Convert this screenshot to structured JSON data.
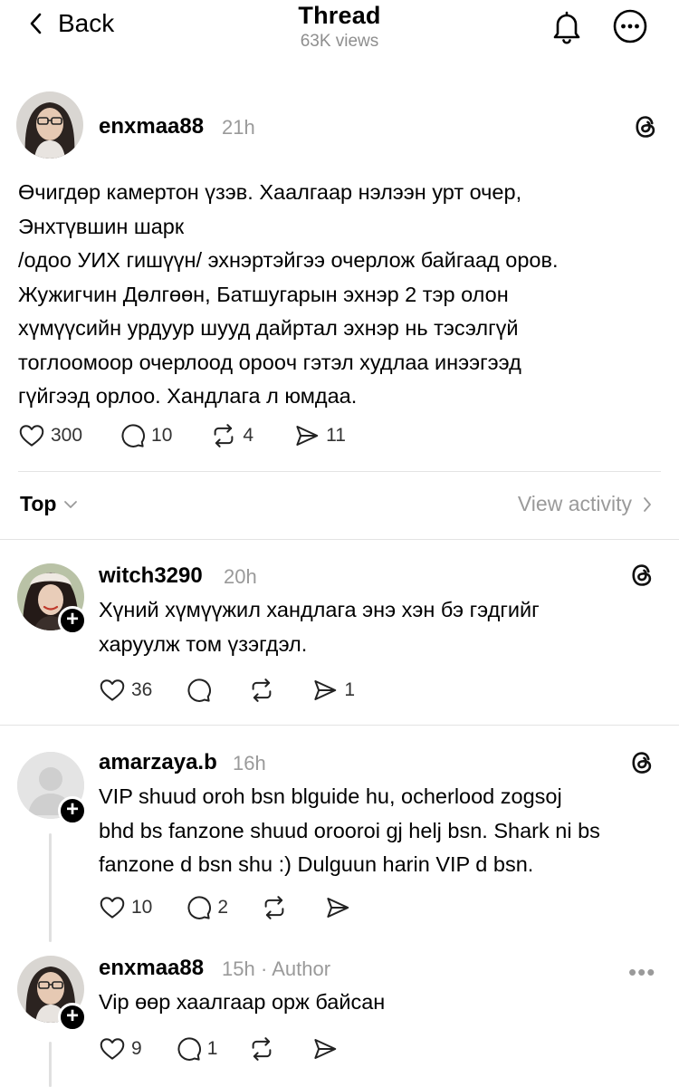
{
  "header": {
    "back_label": "Back",
    "title": "Thread",
    "views": "63K views"
  },
  "post": {
    "username": "enxmaa88",
    "time": "21h",
    "lines": [
      "Өчигдөр камертон үзэв. Хаалгаар нэлээн урт очер,",
      "Энхтүвшин шарк",
      "/одоо УИХ гишүүн/ эхнэртэйгээ очерлож байгаад оров.",
      "Жужигчин Дөлгөөн, Батшугарын эхнэр 2 тэр олон",
      "хүмүүсийн урдуур шууд дайртал эхнэр нь тэсэлгүй",
      "тоглоомоор очерлоод ороoч гэтэл худлаа инээгээд",
      "гүйгээд орлоо. Хандлага л юмдаа."
    ],
    "likes": "300",
    "comments": "10",
    "reposts": "4",
    "shares": "11"
  },
  "sort": {
    "label": "Top",
    "view_activity": "View activity"
  },
  "replies": [
    {
      "username": "witch3290",
      "time": "20h",
      "lines": [
        "Хүний хүмүүжил хандлага  энэ хэн бэ гэдгийг",
        "харуулж том үзэгдэл."
      ],
      "likes": "36",
      "comments": "",
      "reposts": "",
      "shares": "1"
    },
    {
      "username": "amarzaya.b",
      "time": "16h",
      "lines": [
        "VIP shuud oroh bsn blguide hu, ocherlood zogsoj",
        "bhd bs fanzone shuud orooroi gj helj bsn. Shark ni bs",
        "fanzone d bsn shu :) Dulguun harin VIP d bsn."
      ],
      "likes": "10",
      "comments": "2",
      "reposts": "",
      "shares": ""
    },
    {
      "username": "enxmaa88",
      "time": "15h",
      "author_tag": "· Author",
      "lines": [
        "Vip өөр хаалгаар орж байсан"
      ],
      "likes": "9",
      "comments": "1",
      "reposts": "",
      "shares": ""
    }
  ],
  "icons": {
    "back": "chevron-left-icon",
    "bell": "bell-icon",
    "more": "more-circle-icon",
    "threads": "threads-logo-icon",
    "like": "heart-icon",
    "comment": "comment-icon",
    "repost": "repost-icon",
    "share": "send-icon"
  },
  "colors": {
    "text": "#000000",
    "secondary": "#9a9a9a",
    "divider": "#e3e3e3"
  }
}
